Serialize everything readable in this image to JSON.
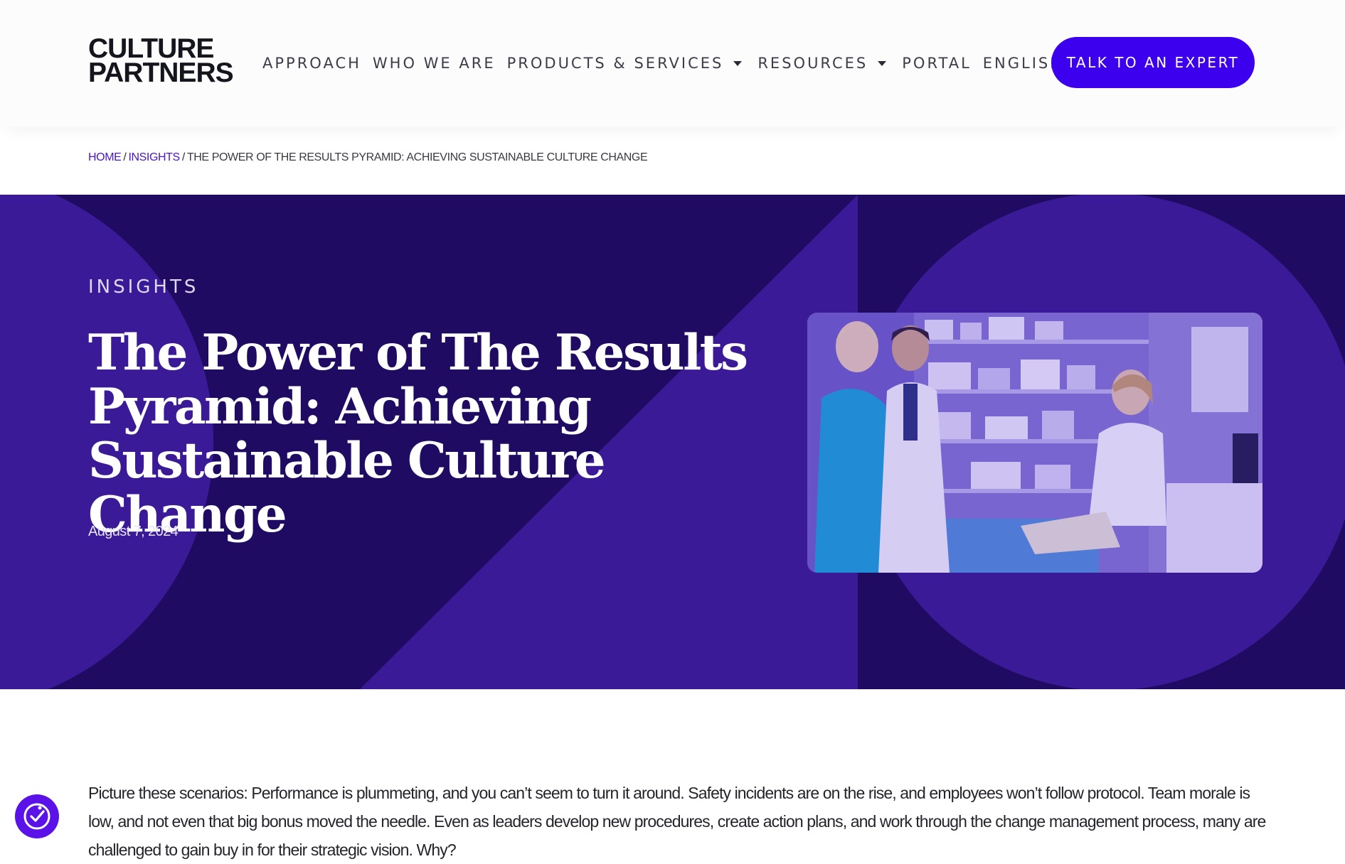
{
  "header": {
    "logo": {
      "line1": "CULTURE",
      "line2": "PARTNERS"
    },
    "nav": [
      {
        "label": "APPROACH",
        "has_dropdown": false
      },
      {
        "label": "WHO WE ARE",
        "has_dropdown": false
      },
      {
        "label": "PRODUCTS & SERVICES",
        "has_dropdown": true
      },
      {
        "label": "RESOURCES",
        "has_dropdown": true
      },
      {
        "label": "PORTAL",
        "has_dropdown": false
      },
      {
        "label": "ENGLISH",
        "has_dropdown": true
      }
    ],
    "cta_label": "TALK TO AN EXPERT"
  },
  "breadcrumb": {
    "home": "HOME",
    "insights": "INSIGHTS",
    "separator": "/",
    "current": "THE POWER OF THE RESULTS PYRAMID: ACHIEVING SUSTAINABLE CULTURE CHANGE"
  },
  "hero": {
    "eyebrow": "INSIGHTS",
    "title": "The Power of The Results Pyramid: Achieving Sustainable Culture Change",
    "date": "August 7, 2024",
    "image_icon": "photo-of-healthcare-workers"
  },
  "article": {
    "intro": "Picture these scenarios: Performance is plummeting, and you can’t seem to turn it around. Safety incidents are on the rise, and employees won’t follow protocol. Team morale is low, and not even that big bonus moved the needle. Even as leaders develop new procedures, create action plans, and work through the change management process, many are challenged to gain buy in for their strategic vision. Why?"
  },
  "accessibility": {
    "icon": "accessibility-icon"
  },
  "colors": {
    "brand_purple": "#3c00ee",
    "hero_dark": "#200b63",
    "hero_mid": "#3a1a96",
    "link_purple": "#4a14c8"
  }
}
